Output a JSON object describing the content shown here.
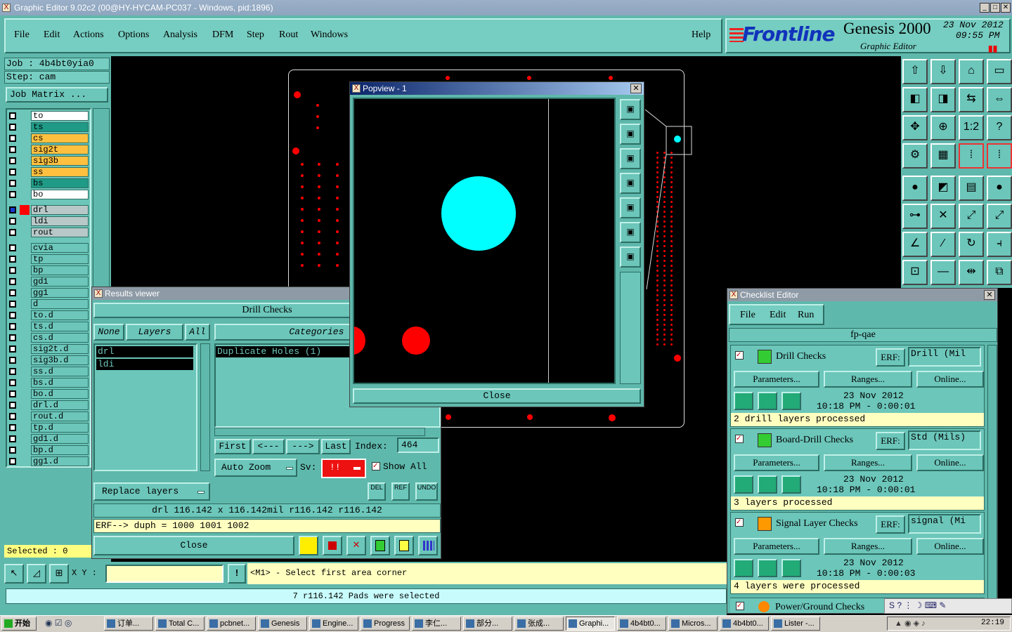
{
  "window": {
    "title": "Graphic Editor 9.02c2 (00@HY-HYCAM-PC037 - Windows, pid:1896)"
  },
  "menu": {
    "items": [
      "File",
      "Edit",
      "Actions",
      "Options",
      "Analysis",
      "DFM",
      "Step",
      "Rout",
      "Windows"
    ],
    "help": "Help"
  },
  "brand": {
    "logo": "Frontline",
    "product": "Genesis 2000",
    "subtitle": "Graphic Editor",
    "date": "23 Nov 2012",
    "time": "09:55 PM"
  },
  "job": {
    "job_label": "Job : 4b4bt0yia0",
    "step_label": "Step: cam",
    "matrix_button": "Job Matrix ..."
  },
  "layers": [
    {
      "name": "to",
      "color": "#ffffff"
    },
    {
      "name": "ts",
      "color": "#1f9a86"
    },
    {
      "name": "cs",
      "color": "#ffc040"
    },
    {
      "name": "sig2t",
      "color": "#ffc040"
    },
    {
      "name": "sig3b",
      "color": "#ffc040"
    },
    {
      "name": "ss",
      "color": "#ffc040"
    },
    {
      "name": "bs",
      "color": "#1f9a86"
    },
    {
      "name": "bo",
      "color": "#ffffff"
    },
    {
      "name": "drl",
      "color": "#b8c8c8"
    },
    {
      "name": "ldi",
      "color": "#b8c8c8"
    },
    {
      "name": "rout",
      "color": "#b8c8c8"
    },
    {
      "name": "cvia",
      "color": "#6cc6ba"
    },
    {
      "name": "tp",
      "color": "#6cc6ba"
    },
    {
      "name": "bp",
      "color": "#6cc6ba"
    },
    {
      "name": "gd1",
      "color": "#6cc6ba"
    },
    {
      "name": "gg1",
      "color": "#6cc6ba"
    },
    {
      "name": "d",
      "color": "#6cc6ba"
    },
    {
      "name": "to.d",
      "color": "#6cc6ba"
    },
    {
      "name": "ts.d",
      "color": "#6cc6ba"
    },
    {
      "name": "cs.d",
      "color": "#6cc6ba"
    },
    {
      "name": "sig2t.d",
      "color": "#6cc6ba"
    },
    {
      "name": "sig3b.d",
      "color": "#6cc6ba"
    },
    {
      "name": "ss.d",
      "color": "#6cc6ba"
    },
    {
      "name": "bs.d",
      "color": "#6cc6ba"
    },
    {
      "name": "bo.d",
      "color": "#6cc6ba"
    },
    {
      "name": "drl.d",
      "color": "#6cc6ba"
    },
    {
      "name": "rout.d",
      "color": "#6cc6ba"
    },
    {
      "name": "tp.d",
      "color": "#6cc6ba"
    },
    {
      "name": "gd1.d",
      "color": "#6cc6ba"
    },
    {
      "name": "bp.d",
      "color": "#6cc6ba"
    },
    {
      "name": "gg1.d",
      "color": "#6cc6ba"
    }
  ],
  "selected_label": "Selected : 0",
  "results": {
    "title": "Results viewer",
    "header": "Drill Checks",
    "none_btn": "None",
    "layers_btn": "Layers",
    "all_btn": "All",
    "categories": "Categories (1)",
    "layer_items": [
      "drl",
      "ldi"
    ],
    "category_items": [
      "Duplicate Holes (1)"
    ],
    "first": "First",
    "prev": "<---",
    "next": "--->",
    "last": "Last",
    "index_label": "Index:",
    "index_value": "464",
    "autozoom": "Auto Zoom",
    "sv_label": "Sv:",
    "sv_value": "!!",
    "show_all": "Show All",
    "replace": "Replace layers",
    "info1": "drl 116.142 x 116.142mil r116.142 r116.142",
    "info2": "ERF--> duph = 1000 1001 1002",
    "close": "Close",
    "del": "DEL",
    "ref": "REF",
    "undo": "UNDO"
  },
  "popview": {
    "title": "Popview - 1",
    "close": "Close"
  },
  "checklist": {
    "title": "Checklist Editor",
    "menu": [
      "File",
      "Edit",
      "Run"
    ],
    "name": "fp-qae",
    "checks": [
      {
        "name": "Drill Checks",
        "erf": "ERF:",
        "erf_value": "Drill (Mil",
        "params": "Parameters...",
        "ranges": "Ranges...",
        "online": "Online...",
        "date": "23 Nov 2012",
        "time": "10:18 PM - 0:00:01",
        "status": "2 drill layers processed"
      },
      {
        "name": "Board-Drill Checks",
        "erf": "ERF:",
        "erf_value": "Std (Mils)",
        "params": "Parameters...",
        "ranges": "Ranges...",
        "online": "Online...",
        "date": "23 Nov 2012",
        "time": "10:18 PM - 0:00:01",
        "status": "3 layers processed"
      },
      {
        "name": "Signal Layer Checks",
        "erf": "ERF:",
        "erf_value": "signal (Mi",
        "params": "Parameters...",
        "ranges": "Ranges...",
        "online": "Online...",
        "date": "23 Nov 2012",
        "time": "10:18 PM - 0:00:03",
        "status": "4 layers were processed"
      }
    ],
    "partial": "Power/Ground Checks"
  },
  "command": {
    "xy_label": "X Y :",
    "xy_value": "",
    "hint": "<M1> - Select first area corner"
  },
  "status": "7 r116.142 Pads were selected",
  "taskbar": {
    "start": "开始",
    "items": [
      "订单...",
      "Total C...",
      "pcbnet...",
      "Genesis",
      "Engine...",
      "Progress",
      "李仁...",
      "部分...",
      "张成...",
      "Graphi...",
      "4b4bt0...",
      "Micros...",
      "4b4bt0...",
      "Lister -..."
    ],
    "clock": "22:19"
  }
}
